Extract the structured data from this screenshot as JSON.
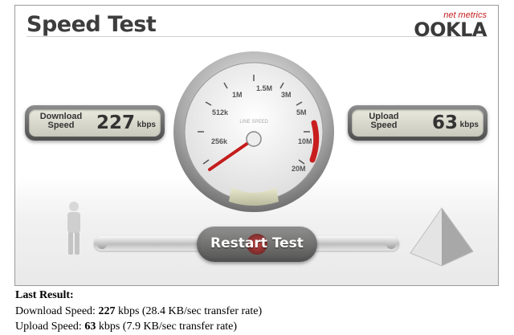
{
  "app": {
    "title": "Speed Test",
    "logo": {
      "tagline": "net metrics",
      "word": "OOKLA"
    }
  },
  "download_panel": {
    "label_line1": "Download",
    "label_line2": "Speed",
    "value": "227",
    "unit": "kbps"
  },
  "upload_panel": {
    "label_line1": "Upload",
    "label_line2": "Speed",
    "value": "63",
    "unit": "kbps"
  },
  "gauge": {
    "ticks": [
      "256k",
      "512k",
      "1M",
      "1.5M",
      "3M",
      "5M",
      "10M",
      "20M"
    ],
    "caption": "LINE SPEED"
  },
  "restart_button": {
    "label": "Restart Test"
  },
  "results": {
    "heading": "Last Result:",
    "download_label": "Download Speed:",
    "download_value": "227",
    "download_rest": "kbps (28.4 KB/sec transfer rate)",
    "upload_label": "Upload Speed:",
    "upload_value": "63",
    "upload_rest": "kbps (7.9 KB/sec transfer rate)"
  },
  "colors": {
    "accent_red": "#c41c1c",
    "panel_dark": "#4e4e4e",
    "display_bg": "#dcdcd0"
  }
}
